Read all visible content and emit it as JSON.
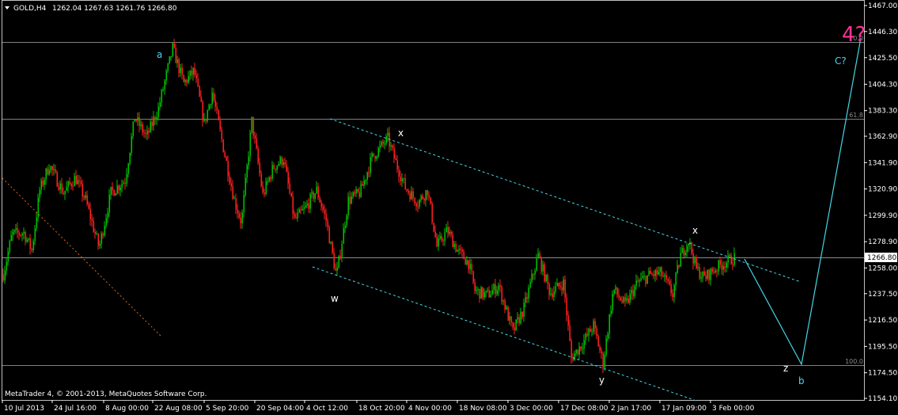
{
  "chart_window": {
    "title": "GOLD,H4",
    "ohlc": "1262.04 1267.63 1261.76 1266.80",
    "copyright": "MetaTrader 4, © 2001-2013, MetaQuotes Software Corp.",
    "current_price_label": "1266.80",
    "count_label": "4?",
    "colors": {
      "background": "#000000",
      "bull_candle": "#00c000",
      "bear_candle": "#ff2020",
      "channel": "#44d6e6",
      "wave_label": "#4fd2f5",
      "count_label": "#ff3399",
      "fibo_line": "#808080",
      "axis": "#ffffff"
    },
    "fibo_labels": {
      "level_0": "0.0",
      "level_61_8": "61.8",
      "level_100": "100.0"
    },
    "wave_labels": {
      "a": "a",
      "x1": "x",
      "x2": "x",
      "w": "w",
      "y": "y",
      "z": "z",
      "b": "b",
      "c": "C?"
    }
  },
  "chart_data": {
    "type": "candlestick",
    "symbol": "GOLD",
    "timeframe": "H4",
    "ylim": [
      1154.1,
      1467.0
    ],
    "y_ticks": [
      "1467.00",
      "1446.30",
      "1425.50",
      "1404.30",
      "1383.30",
      "1362.90",
      "1341.90",
      "1320.90",
      "1299.90",
      "1278.90",
      "1258.00",
      "1237.50",
      "1216.50",
      "1195.50",
      "1174.50",
      "1154.10"
    ],
    "x_ticks": [
      "10 Jul 2013",
      "24 Jul 16:00",
      "8 Aug 00:00",
      "22 Aug 08:00",
      "5 Sep 20:00",
      "20 Sep 04:00",
      "4 Oct 12:00",
      "18 Oct 20:00",
      "4 Nov 00:00",
      "18 Nov 08:00",
      "3 Dec 00:00",
      "17 Dec 08:00",
      "2 Jan 17:00",
      "17 Jan 09:00",
      "3 Feb 00:00"
    ],
    "last_price": 1266.8,
    "fibonacci_levels": [
      {
        "level": "0.0",
        "price": 1436.0
      },
      {
        "level": "61.8",
        "price": 1377.5
      },
      {
        "level": "100.0",
        "price": 1180.5
      }
    ],
    "swing_points": [
      {
        "label": "a",
        "date": "28 Aug 2013",
        "price": 1433
      },
      {
        "label": "x",
        "date": "28 Oct 2013",
        "price": 1361
      },
      {
        "label": "w",
        "date": "15 Oct 2013",
        "price": 1251
      },
      {
        "label": "y",
        "date": "31 Dec 2013",
        "price": 1182
      },
      {
        "label": "x",
        "date": "28 Jan 2014",
        "price": 1280
      },
      {
        "label": "z",
        "price": 1180
      },
      {
        "label": "b",
        "price": 1180
      },
      {
        "label": "C?",
        "price": 1436
      }
    ],
    "projection": [
      {
        "date": "7 Feb 2014",
        "price": 1266
      },
      {
        "date": "25 Feb 2014",
        "price": 1180
      },
      {
        "date": "14 Apr 2014",
        "price": 1436
      }
    ]
  }
}
